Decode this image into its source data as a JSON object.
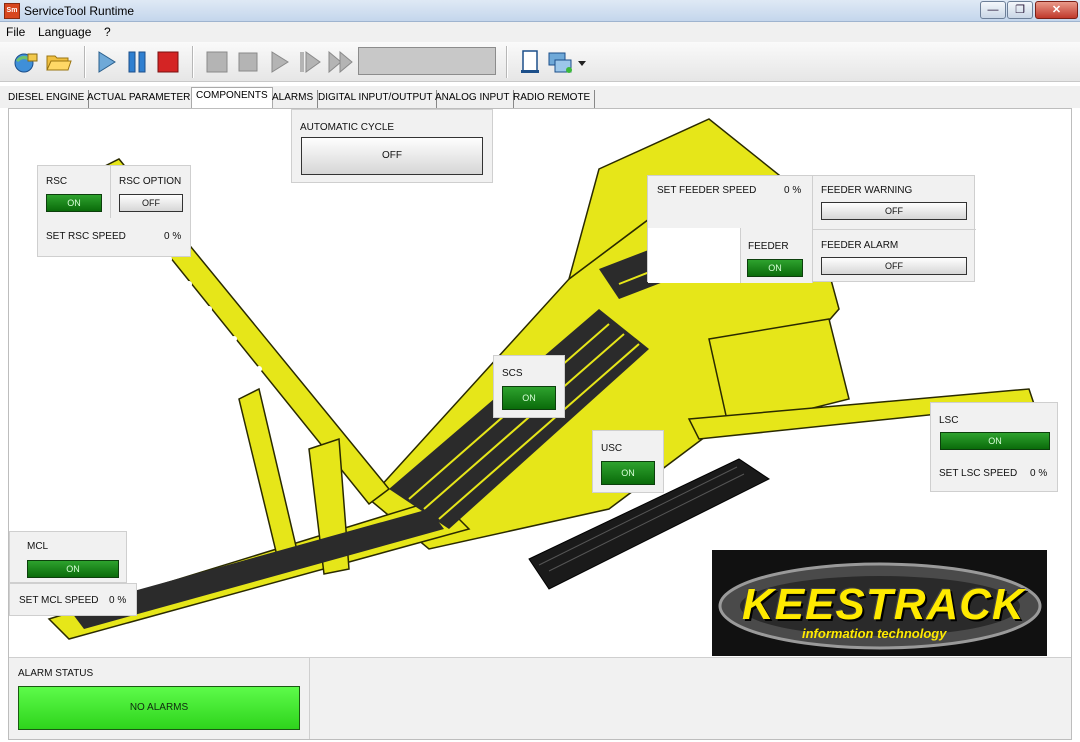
{
  "window": {
    "title": "ServiceTool Runtime",
    "icon_text": "Sm"
  },
  "menu": [
    "File",
    "Language",
    "?"
  ],
  "toolbar": {
    "icons": [
      "connect-icon",
      "folder-open-icon",
      "play-icon",
      "pause-icon",
      "stop-icon",
      "record-icon",
      "stop-gray-icon",
      "play-gray-icon",
      "step-icon",
      "fast-forward-icon",
      "document-icon",
      "network-icon",
      "dropdown-arrow-icon"
    ]
  },
  "tabs": [
    "DIESEL ENGINE",
    "ACTUAL PARAMETERS",
    "COMPONENTS",
    "ALARMS",
    "DIGITAL INPUT/OUTPUT",
    "ANALOG INPUT",
    "RADIO REMOTE"
  ],
  "active_tab": "COMPONENTS",
  "components": {
    "automatic_cycle": {
      "label": "AUTOMATIC CYCLE",
      "state": "OFF"
    },
    "rsc": {
      "label": "RSC",
      "state": "ON"
    },
    "rsc_option": {
      "label": "RSC OPTION",
      "state": "OFF"
    },
    "set_rsc_speed": {
      "label": "SET RSC SPEED",
      "value": "0 %"
    },
    "set_feeder_speed": {
      "label": "SET FEEDER SPEED",
      "value": "0 %"
    },
    "feeder_warning": {
      "label": "FEEDER WARNING",
      "state": "OFF"
    },
    "feeder": {
      "label": "FEEDER",
      "state": "ON"
    },
    "feeder_alarm": {
      "label": "FEEDER ALARM",
      "state": "OFF"
    },
    "scs": {
      "label": "SCS",
      "state": "ON"
    },
    "usc": {
      "label": "USC",
      "state": "ON"
    },
    "lsc": {
      "label": "LSC",
      "state": "ON"
    },
    "set_lsc_speed": {
      "label": "SET LSC SPEED",
      "value": "0 %"
    },
    "mcl": {
      "label": "MCL",
      "state": "ON"
    },
    "set_mcl_speed": {
      "label": "SET MCL SPEED",
      "value": "0 %"
    }
  },
  "logo": {
    "brand": "KEESTRACK",
    "tagline": "information technology"
  },
  "alarm_status": {
    "label": "ALARM STATUS",
    "value": "NO ALARMS"
  },
  "colors": {
    "machine_yellow": "#e6e619",
    "on_green": "#138a13",
    "alarm_ok": "#46e633"
  }
}
